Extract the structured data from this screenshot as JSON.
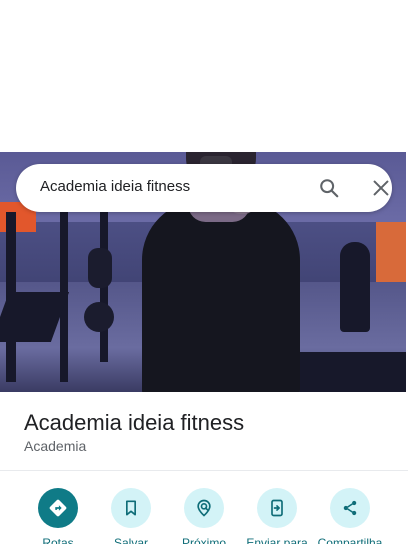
{
  "search": {
    "query": "Academia ideia fitness"
  },
  "place": {
    "name": "Academia ideia fitness",
    "category": "Academia"
  },
  "actions": [
    {
      "label": "Rotas",
      "icon": "directions-icon"
    },
    {
      "label": "Salvar",
      "icon": "bookmark-icon"
    },
    {
      "label": "Próximo",
      "icon": "nearby-icon"
    },
    {
      "label": "Enviar para",
      "icon": "send-to-phone-icon"
    },
    {
      "label": "Compartilha",
      "icon": "share-icon"
    }
  ],
  "colors": {
    "primary": "#0f7b87",
    "chip": "#d3f3f7",
    "label": "#0f6d78"
  }
}
